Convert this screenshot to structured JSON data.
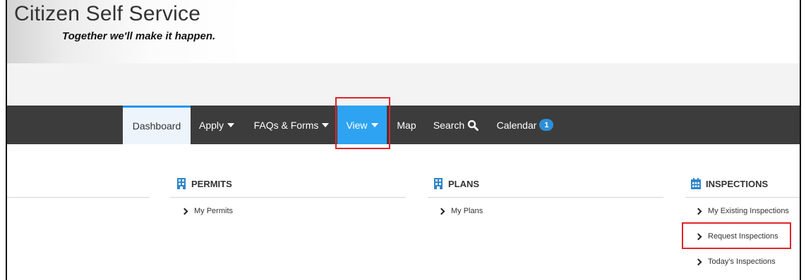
{
  "header": {
    "title": "Citizen Self Service",
    "tagline": "Together we'll make it happen."
  },
  "nav": {
    "items": [
      {
        "label": "Dashboard",
        "state": "active"
      },
      {
        "label": "Apply",
        "dropdown": true
      },
      {
        "label": "FAQs & Forms",
        "dropdown": true
      },
      {
        "label": "View",
        "dropdown": true,
        "state": "selected"
      },
      {
        "label": "Map"
      },
      {
        "label": "Search",
        "icon": "search-icon"
      },
      {
        "label": "Calendar",
        "badge": "1"
      }
    ]
  },
  "sections": [
    {
      "title": "PERMITS",
      "icon": "building-icon",
      "links": [
        "My Permits"
      ]
    },
    {
      "title": "PLANS",
      "icon": "building-icon",
      "links": [
        "My Plans"
      ]
    },
    {
      "title": "INSPECTIONS",
      "icon": "calendar-icon",
      "links": [
        "My Existing Inspections",
        "Request Inspections",
        "Today's Inspections"
      ]
    }
  ],
  "colors": {
    "navbar": "#3c3c3c",
    "accent": "#2ea3f2",
    "highlight": "#e0242b",
    "icon_blue": "#2e86c8"
  }
}
